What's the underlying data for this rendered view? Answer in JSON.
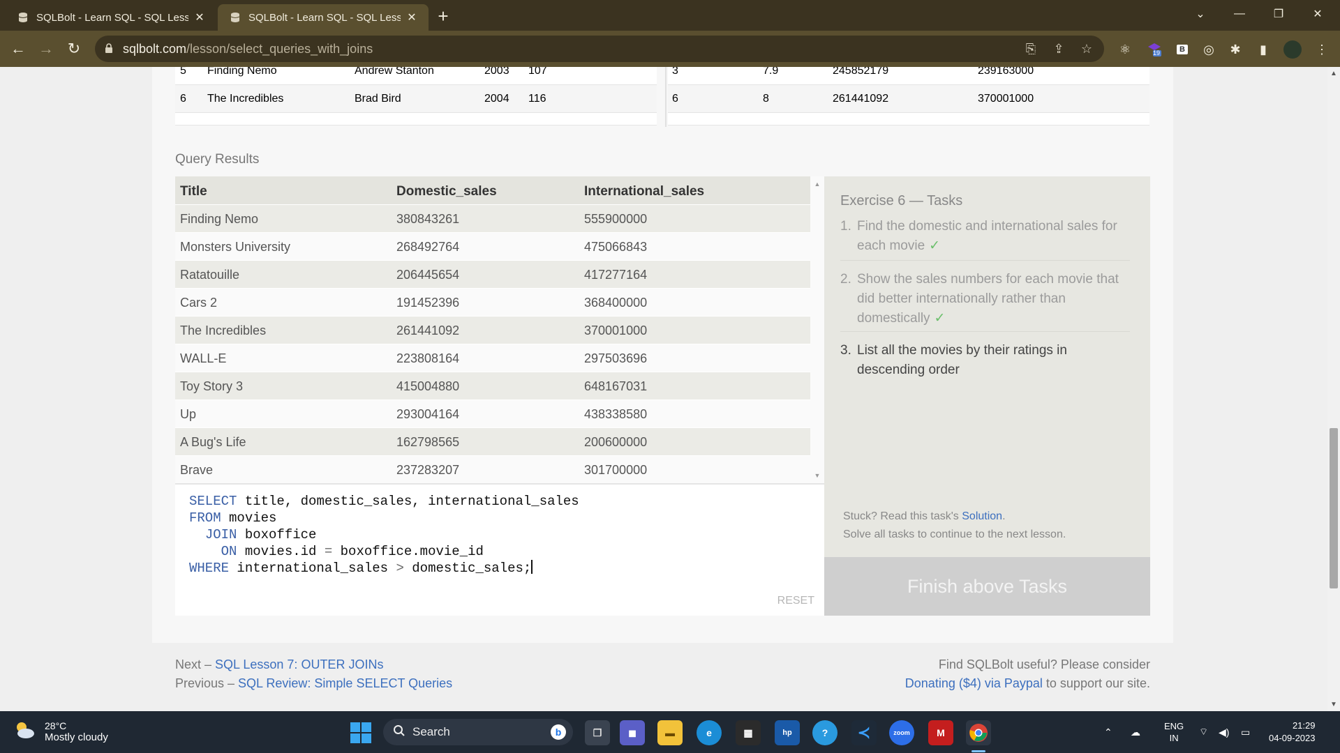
{
  "browser": {
    "tabs": [
      {
        "title": "SQLBolt - Learn SQL - SQL Lesson"
      },
      {
        "title": "SQLBolt - Learn SQL - SQL Lesson"
      }
    ],
    "url_host": "sqlbolt.com",
    "url_path": "/lesson/select_queries_with_joins",
    "extension_badge": "19"
  },
  "top_tables": {
    "movies_rows": [
      {
        "id": "5",
        "title": "Finding Nemo",
        "director": "Andrew Stanton",
        "year": "2003",
        "length": "107"
      },
      {
        "id": "6",
        "title": "The Incredibles",
        "director": "Brad Bird",
        "year": "2004",
        "length": "116"
      }
    ],
    "boxoffice_rows": [
      {
        "movie_id": "3",
        "rating": "7.9",
        "domestic": "245852179",
        "international": "239163000"
      },
      {
        "movie_id": "6",
        "rating": "8",
        "domestic": "261441092",
        "international": "370001000"
      }
    ]
  },
  "query_results": {
    "label": "Query Results",
    "columns": [
      "Title",
      "Domestic_sales",
      "International_sales"
    ],
    "rows": [
      [
        "Finding Nemo",
        "380843261",
        "555900000"
      ],
      [
        "Monsters University",
        "268492764",
        "475066843"
      ],
      [
        "Ratatouille",
        "206445654",
        "417277164"
      ],
      [
        "Cars 2",
        "191452396",
        "368400000"
      ],
      [
        "The Incredibles",
        "261441092",
        "370001000"
      ],
      [
        "WALL-E",
        "223808164",
        "297503696"
      ],
      [
        "Toy Story 3",
        "415004880",
        "648167031"
      ],
      [
        "Up",
        "293004164",
        "438338580"
      ],
      [
        "A Bug's Life",
        "162798565",
        "200600000"
      ],
      [
        "Brave",
        "237283207",
        "301700000"
      ]
    ]
  },
  "editor": {
    "reset_label": "RESET"
  },
  "exercise": {
    "title": "Exercise 6 — Tasks",
    "tasks": [
      {
        "num": "1.",
        "text": "Find the domestic and international sales for each movie",
        "done": true
      },
      {
        "num": "2.",
        "text": "Show the sales numbers for each movie that did better internationally rather than domestically",
        "done": true
      },
      {
        "num": "3.",
        "text": "List all the movies by their ratings in descending order",
        "done": false
      }
    ],
    "check": "✓",
    "stuck_prefix": "Stuck? Read this task's ",
    "solution_link": "Solution",
    "stuck_suffix": ".",
    "continue_hint": "Solve all tasks to continue to the next lesson.",
    "finish_label": "Finish above Tasks"
  },
  "footer": {
    "next_prefix": "Next – ",
    "next_link": "SQL Lesson 7: OUTER JOINs",
    "prev_prefix": "Previous – ",
    "prev_link": "SQL Review: Simple SELECT Queries",
    "useful_text": "Find SQLBolt useful? Please consider",
    "donate_link": "Donating ($4) via Paypal",
    "donate_suffix": " to support our site."
  },
  "taskbar": {
    "temperature": "28°C",
    "weather": "Mostly cloudy",
    "search_placeholder": "Search",
    "lang_line1": "ENG",
    "lang_line2": "IN",
    "time": "21:29",
    "date": "04-09-2023"
  }
}
